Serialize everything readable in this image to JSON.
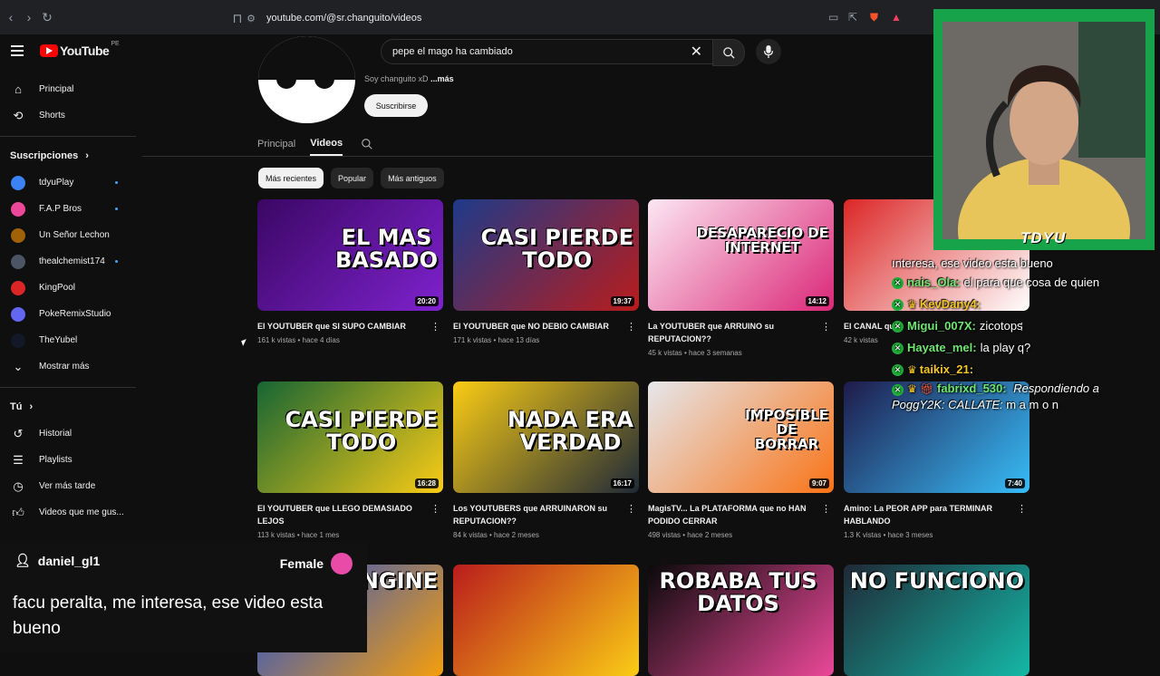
{
  "browser": {
    "url": "youtube.com/@sr.changuito/videos"
  },
  "header": {
    "logo": "YouTube",
    "region": "PE",
    "search_query": "pepe el mago ha cambiado"
  },
  "sidebar": {
    "main": [
      {
        "label": "Principal",
        "icon": "home-icon"
      },
      {
        "label": "Shorts",
        "icon": "shorts-icon"
      }
    ],
    "subscriptions_heading": "Suscripciones",
    "subscriptions": [
      {
        "label": "tdyuPlay",
        "color": "#3b82f6",
        "dot": true
      },
      {
        "label": "F.A.P Bros",
        "color": "#ec4899",
        "dot": true
      },
      {
        "label": "Un Señor Lechon",
        "color": "#a16207",
        "dot": false
      },
      {
        "label": "thealchemist174",
        "color": "#4b5563",
        "dot": true
      },
      {
        "label": "KingPool",
        "color": "#dc2626",
        "dot": false
      },
      {
        "label": "PokeRemixStudio",
        "color": "#6366f1",
        "dot": false
      },
      {
        "label": "TheYubel",
        "color": "#111827",
        "dot": false
      }
    ],
    "show_more": "Mostrar más",
    "you_heading": "Tú",
    "you_items": [
      {
        "label": "Historial",
        "icon": "history-icon"
      },
      {
        "label": "Playlists",
        "icon": "playlist-icon"
      },
      {
        "label": "Ver más tarde",
        "icon": "clock-icon"
      },
      {
        "label": "Videos que me gus...",
        "icon": "thumbs-up-icon"
      }
    ]
  },
  "channel": {
    "description": "Soy changuito xD",
    "more": "...más",
    "subscribe": "Suscribirse",
    "tabs": [
      "Principal",
      "Videos"
    ],
    "chips": [
      "Más recientes",
      "Popular",
      "Más antiguos"
    ]
  },
  "videos": [
    {
      "title": "El YOUTUBER que SI SUPO CAMBIAR",
      "meta": "161 k vistas • hace 4 días",
      "duration": "20:20",
      "thumb_text": "EL MAS\nBASADO",
      "bg": "#3b0764",
      "accent": "#7e22ce"
    },
    {
      "title": "El YOUTUBER que NO DEBIO CAMBIAR",
      "meta": "171 k vistas • hace 13 días",
      "duration": "19:37",
      "thumb_text": "CASI PIERDE\nTODO",
      "bg": "#1e3a8a",
      "accent": "#b91c1c"
    },
    {
      "title": "La YOUTUBER que ARRUINO su REPUTACION??",
      "meta": "45 k vistas • hace 3 semanas",
      "duration": "14:12",
      "thumb_text": "DESAPARECIO DE\nINTERNET",
      "bg": "#fce7f3",
      "accent": "#db2777"
    },
    {
      "title": "El CANAL qu",
      "meta": "42 k vistas",
      "duration": "",
      "thumb_text": "",
      "bg": "#dc2626",
      "accent": "#ffffff"
    },
    {
      "title": "El YOUTUBER que LLEGO DEMASIADO LEJOS",
      "meta": "113 k vistas • hace 1 mes",
      "duration": "16:28",
      "thumb_text": "CASI PIERDE\nTODO",
      "bg": "#166534",
      "accent": "#facc15"
    },
    {
      "title": "Los YOUTUBERS que ARRUINARON su REPUTACION??",
      "meta": "84 k vistas • hace 2 meses",
      "duration": "16:17",
      "thumb_text": "NADA ERA\nVERDAD",
      "bg": "#facc15",
      "accent": "#1f2937"
    },
    {
      "title": "MagisTV... La PLATAFORMA que no HAN PODIDO CERRAR",
      "meta": "498 vistas • hace 2 meses",
      "duration": "9:07",
      "thumb_text": "IMPOSIBLE\nDE\nBORRAR",
      "bg": "#e5e7eb",
      "accent": "#f97316"
    },
    {
      "title": "Amino: La PEOR APP para TERMINAR HABLANDO",
      "meta": "1.3 K vistas • hace 3 meses",
      "duration": "7:40",
      "thumb_text": "",
      "bg": "#1e1b4b",
      "accent": "#38bdf8"
    },
    {
      "title": "",
      "meta": "",
      "duration": "",
      "thumb_text": "NGINE",
      "bg": "#1d4ed8",
      "accent": "#f59e0b"
    },
    {
      "title": "",
      "meta": "",
      "duration": "",
      "thumb_text": "",
      "bg": "#b91c1c",
      "accent": "#facc15"
    },
    {
      "title": "",
      "meta": "",
      "duration": "",
      "thumb_text": "ROBABA TUS DATOS",
      "bg": "#0a0a0a",
      "accent": "#ec4899"
    },
    {
      "title": "",
      "meta": "",
      "duration": "",
      "thumb_text": "NO FUNCIONO",
      "bg": "#1f2937",
      "accent": "#14b8a6"
    }
  ],
  "stream": {
    "cam_name": "TDYU",
    "chat_fragment": "ınteresa, ese video esta bueno",
    "chat": [
      {
        "user": "nais_Ola:",
        "text": "el para que cosa de quien",
        "vip": false
      },
      {
        "user": "KevDany4:",
        "text": "",
        "vip": true
      },
      {
        "user": "Migui_007X:",
        "text": "zicotops",
        "vip": false
      },
      {
        "user": "Hayate_mel:",
        "text": "la play q?",
        "vip": false
      },
      {
        "user": "taikix_21:",
        "text": "",
        "vip": true
      }
    ],
    "long_chat": {
      "user": "fabrixd_530:",
      "reply": "Respondiendo a PoggY2K: CALLATE:",
      "text": "m a m o n"
    },
    "tts_user": "daniel_gl1",
    "tts_gender": "Female",
    "tts_message": "facu peralta, me interesa, ese video esta bueno"
  }
}
